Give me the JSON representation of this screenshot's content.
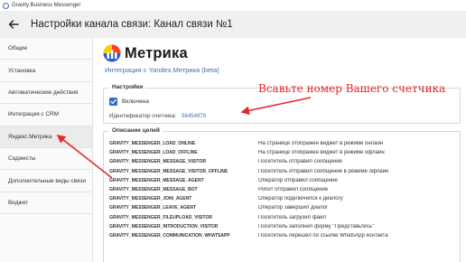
{
  "window": {
    "title": "Gravity Business Messenger"
  },
  "header": {
    "title": "Настройки канала связи: Канал связи №1"
  },
  "sidebar": {
    "items": [
      {
        "label": "Общие"
      },
      {
        "label": "Установка"
      },
      {
        "label": "Автоматические действия"
      },
      {
        "label": "Интеграция с CRM"
      },
      {
        "label": "Яндекс.Метрика"
      },
      {
        "label": "Саджесты"
      },
      {
        "label": "Дополнительные виды связи"
      },
      {
        "label": "Виджет"
      }
    ],
    "active_index": 4
  },
  "main": {
    "logo_text": "Метрика",
    "integration_link": "Интеграция с Yandex.Метрика (beta)",
    "settings": {
      "legend": "Настройки",
      "enabled_label": "Включена",
      "enabled": true,
      "counter_label": "Идентификатор счетчика:",
      "counter_value": "56454979"
    },
    "goals": {
      "legend": "Описание целей",
      "rows": [
        {
          "id": "GRAVITY_MESSENGER_LOAD_ONLINE",
          "desc": "На странице отображен виджет в режиме онлайн"
        },
        {
          "id": "GRAVITY_MESSENGER_LOAD_OFFLINE",
          "desc": "На странице отображен виджет в режиме офлайн"
        },
        {
          "id": "GRAVITY_MESSENGER_MESSAGE_VISITOR",
          "desc": "Посетитель отправил сообщение"
        },
        {
          "id": "GRAVITY_MESSENGER_MESSAGE_VISITOR_OFFLINE",
          "desc": "Посетитель отправил сообщение в режиме офлайн"
        },
        {
          "id": "GRAVITY_MESSENGER_MESSAGE_AGENT",
          "desc": "Оператор отправил сообщение"
        },
        {
          "id": "GRAVITY_MESSENGER_MESSAGE_BOT",
          "desc": "Робот отправил сообщение"
        },
        {
          "id": "GRAVITY_MESSENGER_JOIN_AGENT",
          "desc": "Оператор подключился к диалогу"
        },
        {
          "id": "GRAVITY_MESSENGER_LEAVE_AGENT",
          "desc": "Оператор завершил диалог"
        },
        {
          "id": "GRAVITY_MESSENGER_FILEUPLOAD_VISITOR",
          "desc": "Посетитель загрузил файл"
        },
        {
          "id": "GRAVITY_MESSENGER_INTRODUCTION_VISITOR",
          "desc": "Посетитель заполнил форму \"Представьтесь\""
        },
        {
          "id": "GRAVITY_MESSENGER_COMMUNICATION_WHATSAPP",
          "desc": "Посетитель перешел по ссылке WhatsApp контакта"
        }
      ]
    }
  },
  "annotation": {
    "text": "Всавьте номер Вашего счетчика",
    "color": "#e8262a"
  },
  "colors": {
    "accent": "#2f72c4",
    "link": "#3b6fb0",
    "logo_yellow": "#fc3f1d",
    "logo_blue": "#2a5fd4"
  }
}
